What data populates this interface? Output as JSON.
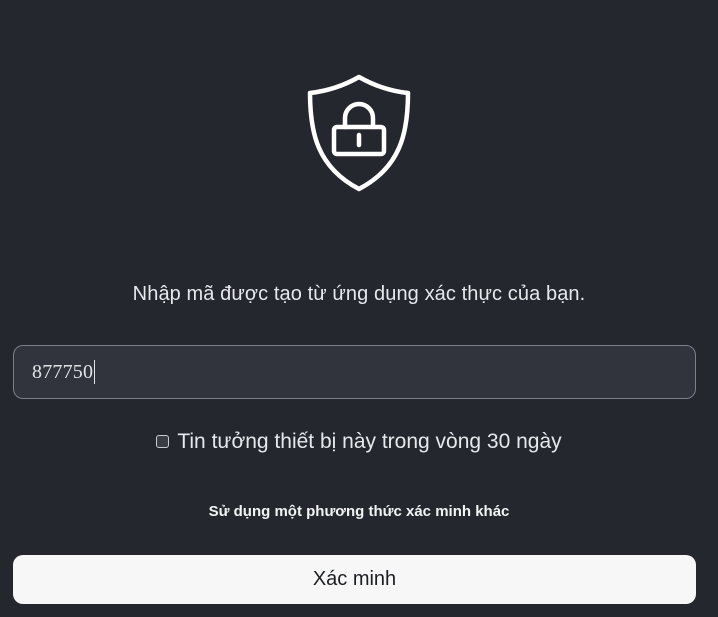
{
  "icons": {
    "main": "shield-lock-icon",
    "checkbox": "checkbox-unchecked"
  },
  "instruction": "Nhập mã được tạo từ ứng dụng xác thực của bạn.",
  "code_input": {
    "value": "877750"
  },
  "trust_device": {
    "checked": false,
    "label": "Tin tưởng thiết bị này trong vòng 30 ngày"
  },
  "alt_method_link": "Sử dụng một phương thức xác minh khác",
  "verify_button": "Xác minh",
  "colors": {
    "background": "#24272e",
    "input_background": "#31343c",
    "input_border": "#7a7f88",
    "button_background": "#f7f7f8",
    "text": "#e6e8ec"
  }
}
